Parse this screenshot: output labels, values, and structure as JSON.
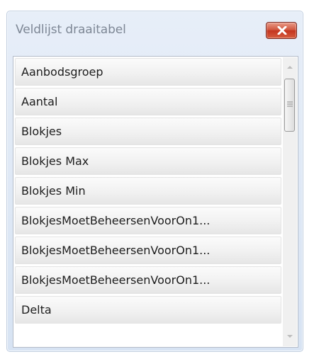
{
  "window": {
    "title": "Veldlijst draaitabel"
  },
  "close_button": {
    "icon": "close-icon",
    "color": "#c4351f"
  },
  "field_list": {
    "items": [
      "Aanbodsgroep",
      "Aantal",
      "Blokjes",
      "Blokjes Max",
      "Blokjes Min",
      "BlokjesMoetBeheersenVoorOn1...",
      "BlokjesMoetBeheersenVoorOn1...",
      "BlokjesMoetBeheersenVoorOn1...",
      "Delta"
    ]
  },
  "scrollbar": {
    "up_icon": "scroll-up-arrow-icon",
    "down_icon": "scroll-down-arrow-icon",
    "thumb_icon": "grip-icon"
  }
}
